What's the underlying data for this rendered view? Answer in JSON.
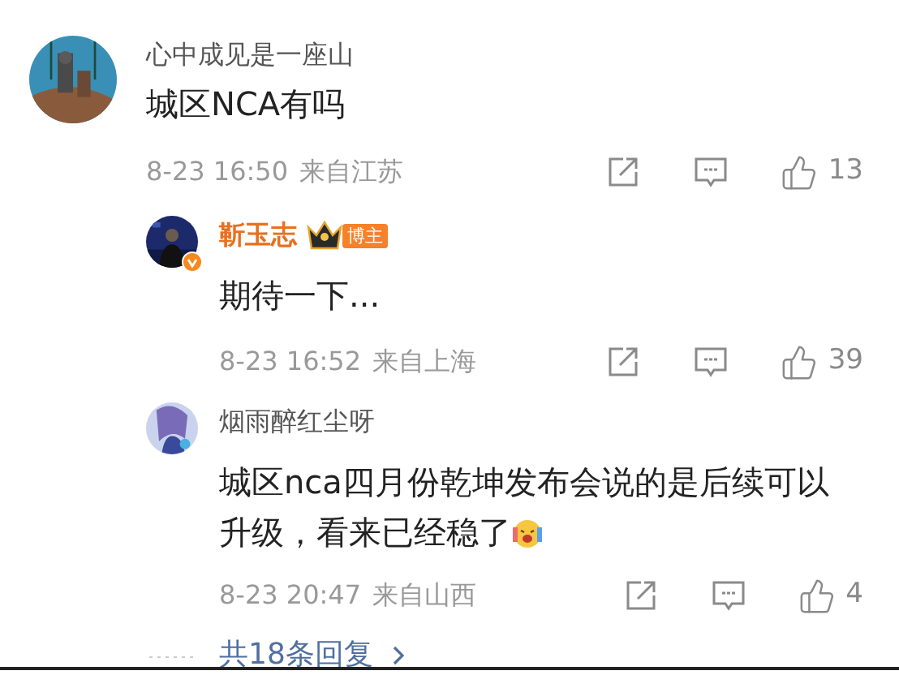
{
  "comment": {
    "author": "心中成见是一座山",
    "text": "城区NCA有吗",
    "time": "8-23 16:50",
    "location": "来自江苏",
    "likes": "13",
    "replies": [
      {
        "author": "靳玉志",
        "verified": true,
        "highlighted": true,
        "badge": "博主",
        "lines": [
          "期待一下..."
        ],
        "emoji": false,
        "time": "8-23 16:52",
        "location": "来自上海",
        "likes": "39"
      },
      {
        "author": "烟雨醉红尘呀",
        "verified": false,
        "highlighted": false,
        "lines": [
          "城区nca四月份乾坤发布会说的是后续可以",
          "升级，看来已经稳了"
        ],
        "emoji": true,
        "time": "8-23 20:47",
        "location": "来自山西",
        "likes": "4"
      }
    ],
    "more_replies": "共18条回复"
  }
}
